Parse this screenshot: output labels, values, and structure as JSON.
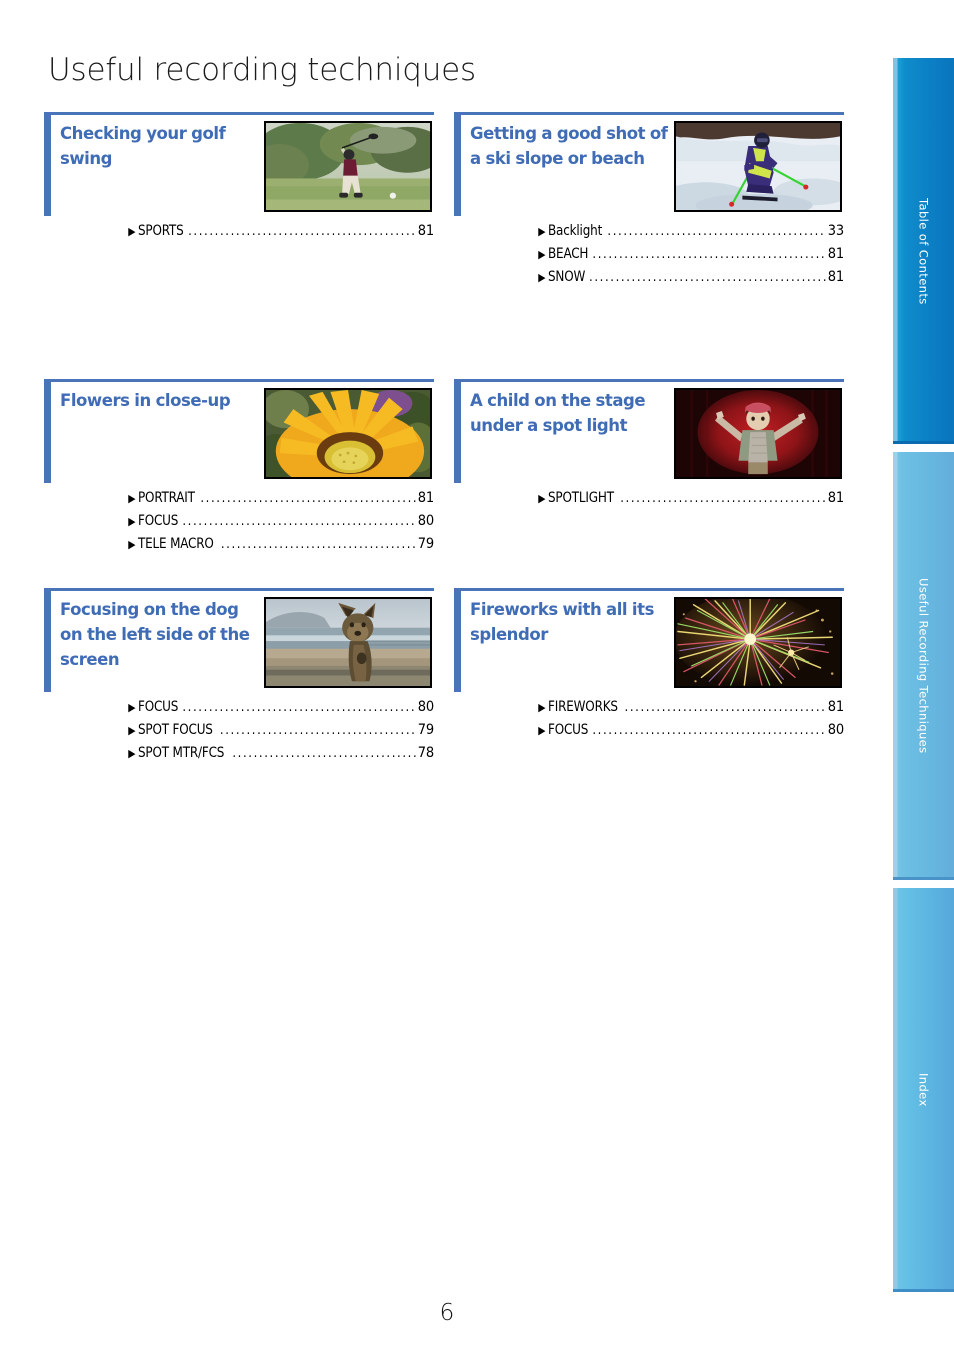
{
  "page": {
    "title": "Useful recording techniques",
    "page_number": "6"
  },
  "colors": {
    "heading_blue": "#3f6cb5",
    "rule_blue": "#4a74b8",
    "tab_active_blue": "#0b7ec4",
    "tab_light_blue": "#66b6df"
  },
  "sections": [
    {
      "title": "Checking your golf swing",
      "image": "golf-swing-thumbnail",
      "entries": [
        {
          "label": "SPORTS",
          "page": "81"
        }
      ]
    },
    {
      "title": "Getting a good shot of a ski slope or beach",
      "image": "ski-slope-thumbnail",
      "entries": [
        {
          "label": "Backlight",
          "page": "33"
        },
        {
          "label": "BEACH",
          "page": "81"
        },
        {
          "label": "SNOW",
          "page": "81"
        }
      ]
    },
    {
      "title": "Flowers in close-up",
      "image": "yellow-flower-thumbnail",
      "entries": [
        {
          "label": "PORTRAIT",
          "page": "81"
        },
        {
          "label": "FOCUS",
          "page": "80"
        },
        {
          "label": "TELE MACRO",
          "page": "79"
        }
      ]
    },
    {
      "title": "A child on the stage under a spot light",
      "image": "child-on-stage-thumbnail",
      "entries": [
        {
          "label": "SPOTLIGHT",
          "page": "81"
        }
      ]
    },
    {
      "title": "Focusing on the dog on the left side of the screen",
      "image": "dog-on-beach-thumbnail",
      "entries": [
        {
          "label": "FOCUS",
          "page": "80"
        },
        {
          "label": "SPOT FOCUS",
          "page": "79"
        },
        {
          "label": "SPOT MTR/FCS",
          "page": "78"
        }
      ]
    },
    {
      "title": "Fireworks with all its splendor",
      "image": "fireworks-thumbnail",
      "entries": [
        {
          "label": "FIREWORKS",
          "page": "81"
        },
        {
          "label": "FOCUS",
          "page": "80"
        }
      ]
    }
  ],
  "tabs": [
    {
      "label": "Table of Contents"
    },
    {
      "label": "Useful Recording Techniques"
    },
    {
      "label": "Index"
    }
  ],
  "bullet_glyph": "▶",
  "dot_leader": "............................................................................................"
}
